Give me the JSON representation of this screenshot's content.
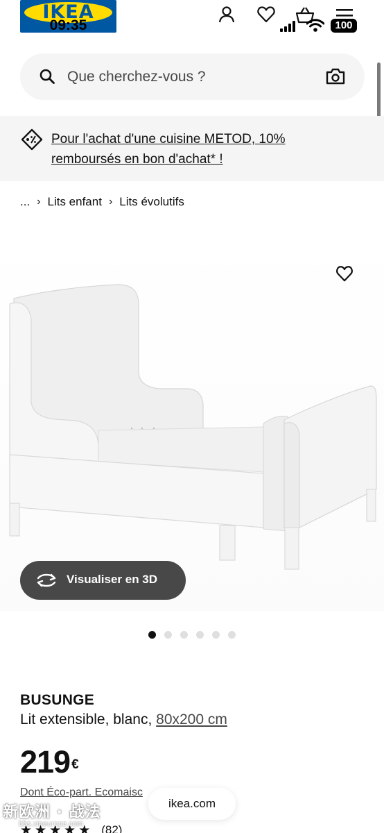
{
  "brand": {
    "logo_text": "IKEA",
    "logo_blue": "#0058a3",
    "logo_yellow": "#ffdb00"
  },
  "status_bar": {
    "time": "09:35",
    "battery": "100"
  },
  "header": {
    "icons": [
      "account-icon",
      "heart-icon",
      "basket-icon",
      "menu-icon"
    ]
  },
  "search": {
    "placeholder": "Que cherchez-vous ?"
  },
  "promo": {
    "text": "Pour l'achat d'une cuisine METOD, 10% remboursés en bon d'achat* !"
  },
  "breadcrumb": {
    "ellipsis": "...",
    "items": [
      "Lits enfant",
      "Lits évolutifs"
    ]
  },
  "gallery": {
    "view_3d_label": "Visualiser en 3D",
    "total_images": 6,
    "active_index": 0
  },
  "product": {
    "name": "BUSUNGE",
    "description": "Lit extensible, blanc,",
    "size": "80x200 cm",
    "price": "219",
    "currency": "€",
    "eco_part": "Dont Éco-part. Ecomaisc",
    "rating_stars": 5,
    "reviews_count": "(82)"
  },
  "browser": {
    "url": "ikea.com"
  },
  "watermark": {
    "text": "新欧洲 · 战法",
    "sub": "bbs.xineurope.com"
  }
}
